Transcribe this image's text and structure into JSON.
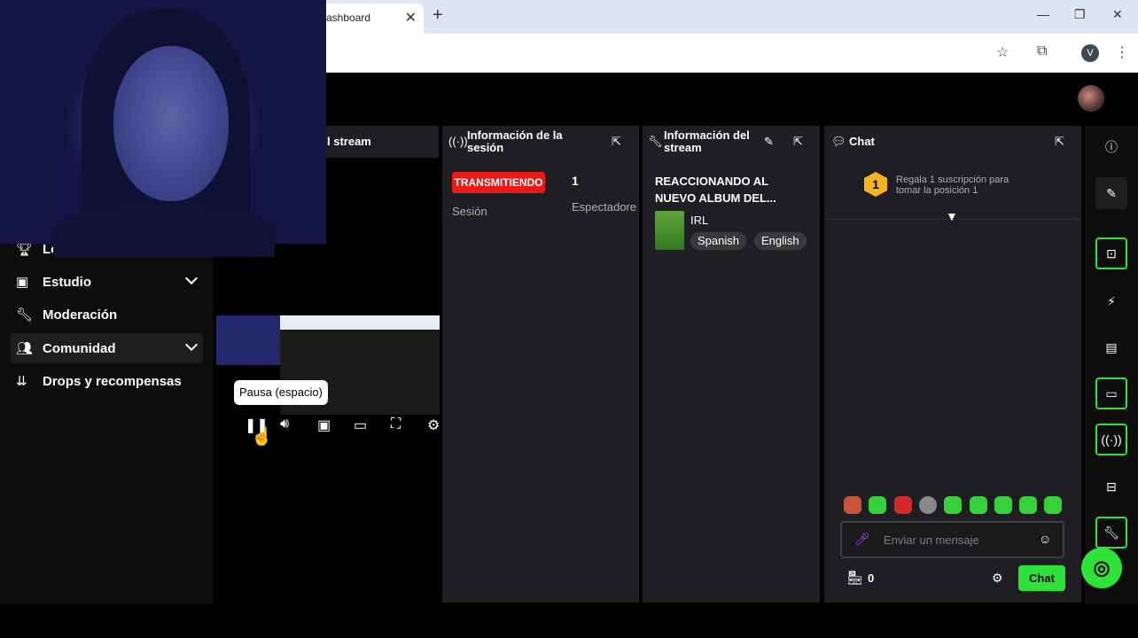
{
  "browser": {
    "tab_title": "ashboard",
    "tab_close": "✕",
    "new_tab": "+",
    "profile_initial": "V",
    "window_controls": {
      "minimize": "—",
      "maximize": "❐",
      "close": "✕"
    }
  },
  "sidebar": {
    "items": [
      {
        "label": "Logros",
        "icon": "trophy-icon"
      },
      {
        "label": "Estudio",
        "icon": "studio-icon",
        "expandable": true
      },
      {
        "label": "Moderación",
        "icon": "wrench-icon"
      },
      {
        "label": "Comunidad",
        "icon": "community-icon",
        "expandable": true,
        "active": true
      },
      {
        "label": "Drops y recompensas",
        "icon": "drops-icon"
      }
    ]
  },
  "video_panel": {
    "title": "l stream",
    "tooltip": "Pausa (espacio)"
  },
  "session_panel": {
    "title": "Información de la sesión",
    "live_badge": "TRANSMITIENDO",
    "viewer_count": "1",
    "session_label": "Sesión",
    "viewers_label": "Espectadore"
  },
  "stream_info_panel": {
    "title": "Información del stream",
    "stream_title": "REACCIONANDO AL NUEVO ALBUM DEL...",
    "category": "IRL",
    "tags": [
      "Spanish",
      "English"
    ]
  },
  "chat_panel": {
    "title": "Chat",
    "gift_rank": "1",
    "gift_text": "Regala 1 suscripción para tomar la posición 1",
    "input_placeholder": "Enviar un mensaje",
    "points": "0",
    "send_label": "Chat"
  },
  "colors": {
    "accent": "#2ee338",
    "live": "#e91916",
    "panel": "#1f1f23"
  }
}
